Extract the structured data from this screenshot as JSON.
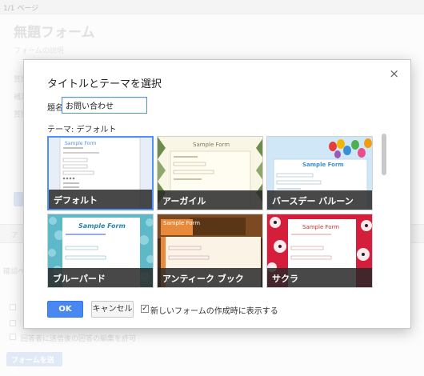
{
  "background": {
    "page_indicator": "1/1 ページ",
    "form_title": "無題フォーム",
    "form_description": "フォームの説明",
    "q_labels": [
      "質問",
      "補足",
      "質問"
    ],
    "section_label": "ア",
    "confirm_label": "確認ペー",
    "edit_after_submit": "回答者に送信後の回答の編集を許可",
    "send_button": "フォームを送信"
  },
  "dialog": {
    "title": "タイトルとテーマを選択",
    "close_symbol": "×",
    "name_label": "題名",
    "name_value": "お問い合わせ",
    "theme_label": "テーマ: デフォルト",
    "themes": [
      {
        "label": "デフォルト",
        "preview_title": "Sample Form",
        "selected": true
      },
      {
        "label": "アーガイル",
        "preview_title": "Sample Form",
        "selected": false
      },
      {
        "label": "バースデー バルーン",
        "preview_title": "Sample Form",
        "selected": false
      },
      {
        "label": "ブルーパード",
        "preview_title": "Sample Form",
        "selected": false
      },
      {
        "label": "アンティーク ブック",
        "preview_title": "Sample Form",
        "selected": false
      },
      {
        "label": "サクラ",
        "preview_title": "Sample Form",
        "selected": false
      }
    ],
    "ok_label": "OK",
    "cancel_label": "キャンセル",
    "checkbox_checked": true,
    "checkbox_mark": "✓",
    "checkbox_label": "新しいフォームの作成時に表示する"
  },
  "colors": {
    "accent": "#4d90fe",
    "ok_button": "#4888f0"
  }
}
